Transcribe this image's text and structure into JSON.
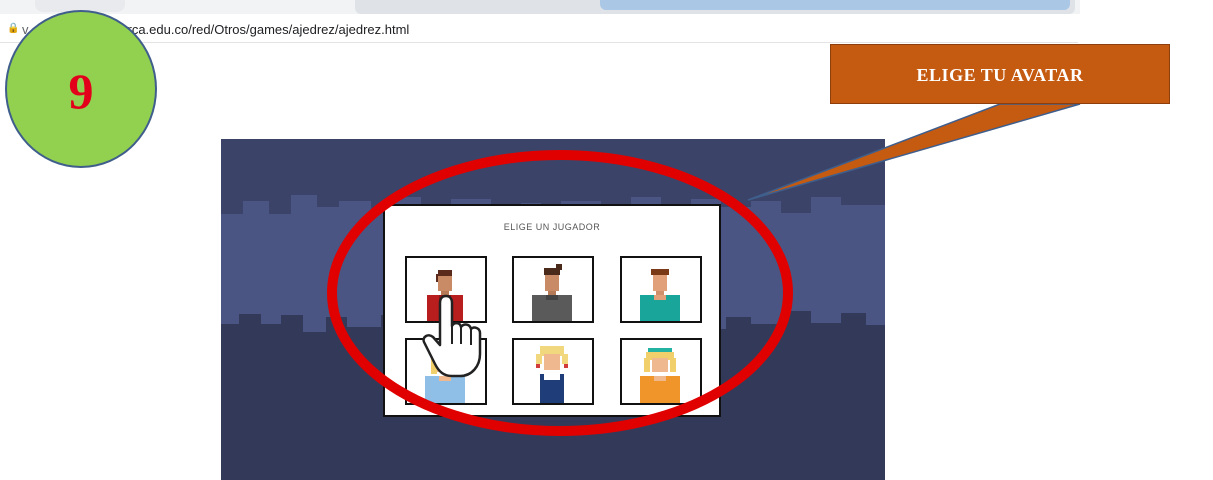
{
  "browser": {
    "url_prefix": "v",
    "url_rest": "rca.edu.co/red/Otros/games/ajedrez/ajedrez.html",
    "lock_icon": "lock-icon"
  },
  "step": {
    "number": "9",
    "color": "#92d050",
    "number_color": "#e3001b"
  },
  "callout": {
    "text": "ELIGE TU AVATAR",
    "color": "#c55a11"
  },
  "game": {
    "panel_title": "ELIGE UN JUGADOR",
    "avatars": [
      {
        "name": "avatar-boy-red-shirt"
      },
      {
        "name": "avatar-boy-gray-shirt"
      },
      {
        "name": "avatar-boy-teal-shirt"
      },
      {
        "name": "avatar-girl-blue-shirt"
      },
      {
        "name": "avatar-girl-overalls"
      },
      {
        "name": "avatar-girl-orange-shirt"
      }
    ],
    "highlight_color": "#e00000"
  }
}
